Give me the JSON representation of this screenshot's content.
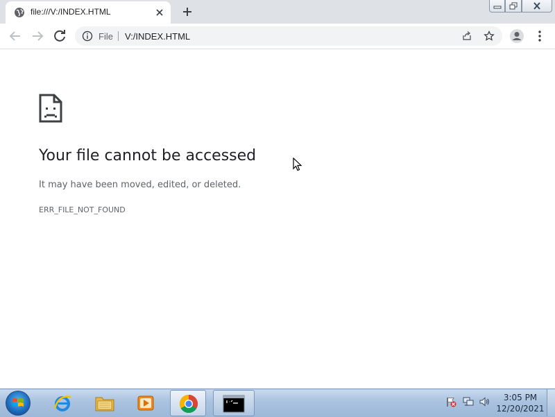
{
  "browser": {
    "tab": {
      "title": "file:///V:/INDEX.HTML",
      "favicon": "globe-icon"
    },
    "new_tab_icon": "plus-icon",
    "window_controls": [
      "minimize-icon",
      "maximize-icon",
      "close-icon"
    ],
    "toolbar": {
      "back_icon": "arrow-left-icon",
      "forward_icon": "arrow-right-icon",
      "reload_icon": "reload-icon"
    },
    "omnibox": {
      "scheme_label": "File",
      "url": "V:/INDEX.HTML",
      "info_icon": "info-icon",
      "share_icon": "share-icon",
      "bookmark_icon": "star-icon"
    },
    "profile_icon": "person-icon",
    "menu_icon": "kebab-menu-icon"
  },
  "page": {
    "error_icon": "sad-file-icon",
    "title": "Your file cannot be accessed",
    "description": "It may have been moved, edited, or deleted.",
    "error_code": "ERR_FILE_NOT_FOUND"
  },
  "taskbar": {
    "start_icon": "windows-logo-icon",
    "pinned": [
      {
        "name": "internet-explorer-icon",
        "state": "pinned"
      },
      {
        "name": "file-explorer-icon",
        "state": "pinned"
      },
      {
        "name": "media-player-icon",
        "state": "pinned"
      },
      {
        "name": "chrome-icon",
        "state": "active"
      },
      {
        "name": "command-prompt-icon",
        "state": "running"
      }
    ],
    "tray": [
      "action-center-flag-icon",
      "network-icon",
      "volume-icon"
    ],
    "clock": {
      "time": "3:05 PM",
      "date": "12/20/2021"
    }
  },
  "colors": {
    "tabstrip_bg": "#dee1e6",
    "omnibox_bg": "#f1f3f4",
    "title_text": "#202124",
    "secondary_text": "#5f6368",
    "taskbar_top": "#c9daee",
    "taskbar_bottom": "#9db8d8"
  }
}
